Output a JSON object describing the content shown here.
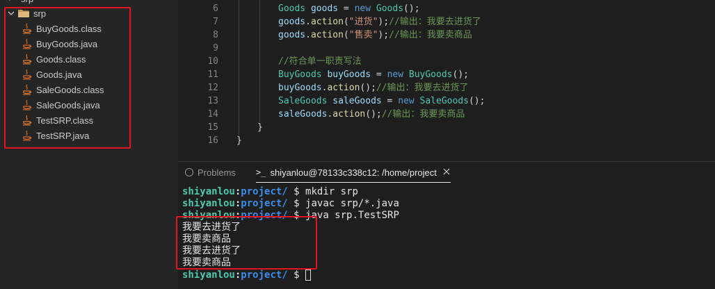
{
  "sidebar": {
    "partial_root_label": "srp",
    "folder_label": "srp",
    "files": [
      {
        "name": "BuyGoods.class",
        "kind": "class"
      },
      {
        "name": "BuyGoods.java",
        "kind": "java"
      },
      {
        "name": "Goods.class",
        "kind": "class"
      },
      {
        "name": "Goods.java",
        "kind": "java"
      },
      {
        "name": "SaleGoods.class",
        "kind": "class"
      },
      {
        "name": "SaleGoods.java",
        "kind": "java"
      },
      {
        "name": "TestSRP.class",
        "kind": "class"
      },
      {
        "name": "TestSRP.java",
        "kind": "java"
      }
    ]
  },
  "editor": {
    "lines": [
      {
        "n": "6",
        "tokens": [
          [
            "t",
            "Goods"
          ],
          [
            "p",
            " "
          ],
          [
            "v",
            "goods"
          ],
          [
            "p",
            " = "
          ],
          [
            "k",
            "new"
          ],
          [
            "p",
            " "
          ],
          [
            "t",
            "Goods"
          ],
          [
            "p",
            "();"
          ]
        ]
      },
      {
        "n": "7",
        "tokens": [
          [
            "v",
            "goods"
          ],
          [
            "p",
            "."
          ],
          [
            "f",
            "action"
          ],
          [
            "p",
            "("
          ],
          [
            "s",
            "\"进货\""
          ],
          [
            "p",
            ");"
          ],
          [
            "c",
            "//输出：我要去进货了"
          ]
        ]
      },
      {
        "n": "8",
        "tokens": [
          [
            "v",
            "goods"
          ],
          [
            "p",
            "."
          ],
          [
            "f",
            "action"
          ],
          [
            "p",
            "("
          ],
          [
            "s",
            "\"售卖\""
          ],
          [
            "p",
            ");"
          ],
          [
            "c",
            "//输出：我要卖商品"
          ]
        ]
      },
      {
        "n": "9",
        "tokens": []
      },
      {
        "n": "10",
        "tokens": [
          [
            "c",
            "//符合单一职责写法"
          ]
        ]
      },
      {
        "n": "11",
        "tokens": [
          [
            "t",
            "BuyGoods"
          ],
          [
            "p",
            " "
          ],
          [
            "v",
            "buyGoods"
          ],
          [
            "p",
            " = "
          ],
          [
            "k",
            "new"
          ],
          [
            "p",
            " "
          ],
          [
            "t",
            "BuyGoods"
          ],
          [
            "p",
            "();"
          ]
        ]
      },
      {
        "n": "12",
        "tokens": [
          [
            "v",
            "buyGoods"
          ],
          [
            "p",
            "."
          ],
          [
            "f",
            "action"
          ],
          [
            "p",
            "();"
          ],
          [
            "c",
            "//输出：我要去进货了"
          ]
        ]
      },
      {
        "n": "13",
        "tokens": [
          [
            "t",
            "SaleGoods"
          ],
          [
            "p",
            " "
          ],
          [
            "v",
            "saleGoods"
          ],
          [
            "p",
            " = "
          ],
          [
            "k",
            "new"
          ],
          [
            "p",
            " "
          ],
          [
            "t",
            "SaleGoods"
          ],
          [
            "p",
            "();"
          ]
        ]
      },
      {
        "n": "14",
        "tokens": [
          [
            "v",
            "saleGoods"
          ],
          [
            "p",
            "."
          ],
          [
            "f",
            "action"
          ],
          [
            "p",
            "();"
          ],
          [
            "c",
            "//输出：我要卖商品"
          ]
        ]
      },
      {
        "n": "15",
        "tokens": [
          [
            "p",
            "}"
          ]
        ]
      },
      {
        "n": "16",
        "tokens": [
          [
            "p",
            "}"
          ]
        ]
      }
    ]
  },
  "panel": {
    "tabs": {
      "problems": "Problems",
      "terminal": "shiyanlou@78133c338c12: /home/project"
    }
  },
  "terminal": {
    "prompt_user": "shiyanlou",
    "prompt_colon": ":",
    "prompt_path": "project/",
    "prompt_suffix": " $ ",
    "commands": [
      "mkdir srp",
      "javac srp/*.java",
      "java srp.TestSRP"
    ],
    "output": [
      "我要去进货了",
      "我要卖商品",
      "我要去进货了",
      "我要卖商品"
    ]
  },
  "colors": {
    "highlight_box": "#e0151d",
    "java_icon": "#e07a2e"
  }
}
